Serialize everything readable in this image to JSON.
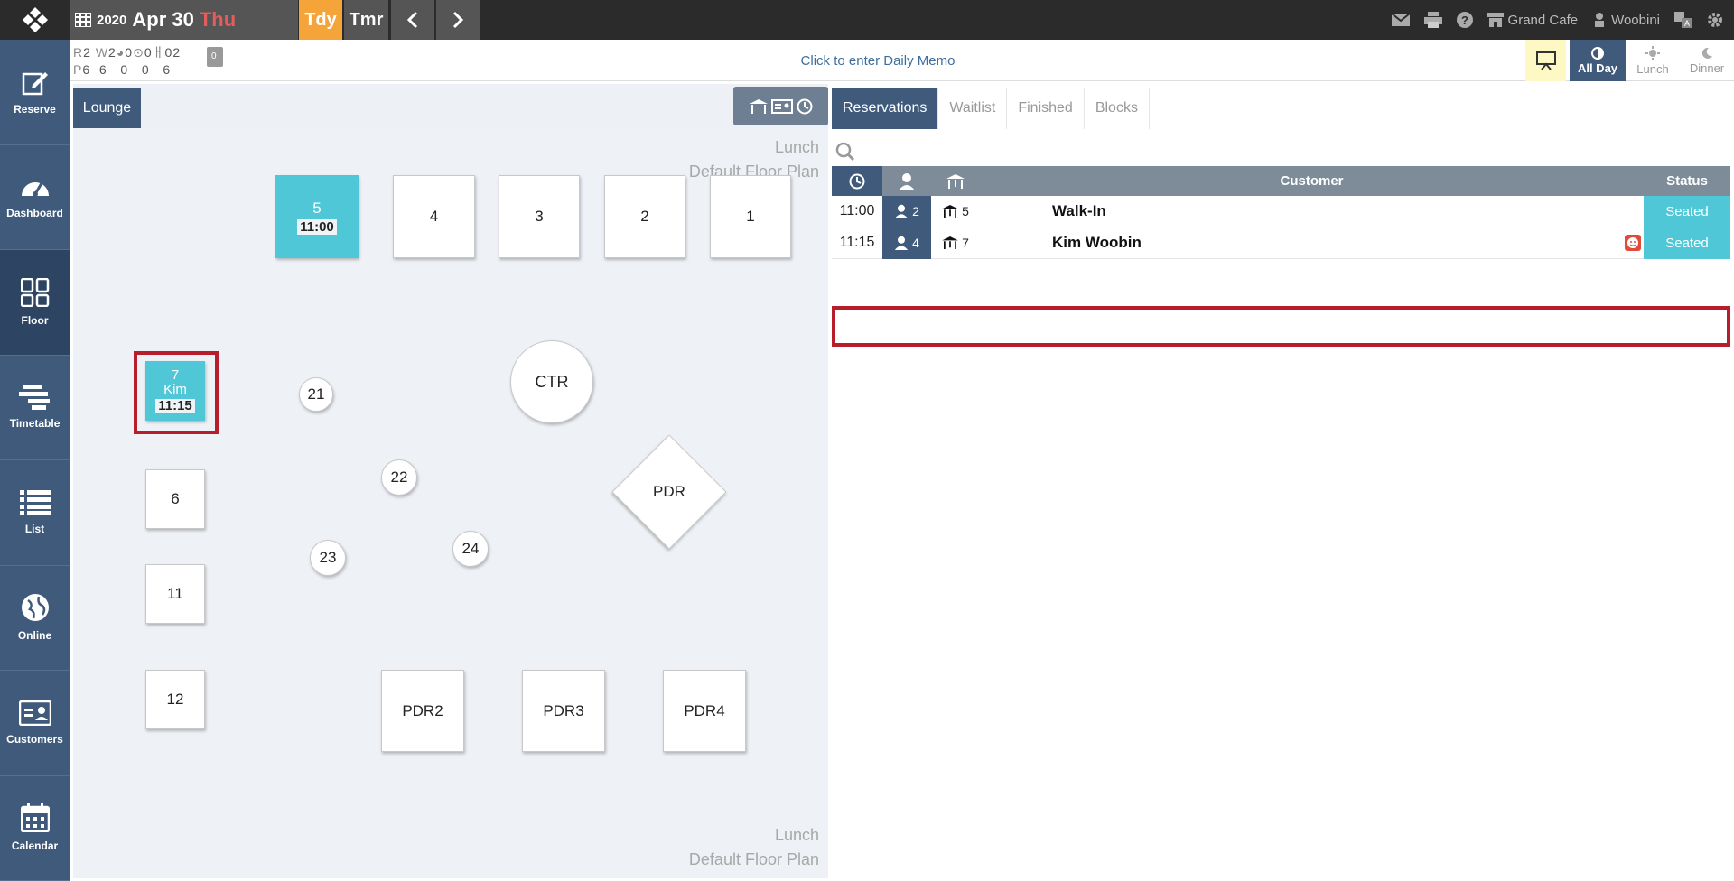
{
  "topbar": {
    "year": "2020",
    "month_day": "Apr 30",
    "weekday": "Thu",
    "today_label": "Tdy",
    "tomorrow_label": "Tmr",
    "restaurant": "Grand Cafe",
    "user": "Woobini"
  },
  "sidebar": {
    "items": [
      {
        "label": "Reserve",
        "icon": "edit-icon"
      },
      {
        "label": "Dashboard",
        "icon": "gauge-icon"
      },
      {
        "label": "Floor",
        "icon": "grid-icon"
      },
      {
        "label": "Timetable",
        "icon": "timeline-icon"
      },
      {
        "label": "List",
        "icon": "list-icon"
      },
      {
        "label": "Online",
        "icon": "globe-icon"
      },
      {
        "label": "Customers",
        "icon": "id-card-icon"
      },
      {
        "label": "Calendar",
        "icon": "calendar-icon"
      }
    ]
  },
  "info": {
    "counts_row1": [
      "R",
      "2",
      "W",
      "2",
      "0",
      "0",
      "0",
      "2"
    ],
    "counts_row2": [
      "P",
      "6",
      "6",
      "0",
      "0",
      "6"
    ],
    "clip_count": "0",
    "memo": "Click to enter Daily Memo",
    "shifts": [
      {
        "label": "All Day",
        "active": true
      },
      {
        "label": "Lunch",
        "active": false
      },
      {
        "label": "Dinner",
        "active": false
      }
    ]
  },
  "floor": {
    "area_tab": "Lounge",
    "shift_label": "Lunch",
    "plan_label": "Default Floor Plan",
    "tables": {
      "t5": {
        "num": "5",
        "time": "11:00"
      },
      "t4": "4",
      "t3": "3",
      "t2": "2",
      "t1": "1",
      "t7": {
        "num": "7",
        "name": "Kim",
        "time": "11:15"
      },
      "t21": "21",
      "tctr": "CTR",
      "t22": "22",
      "tpdr": "PDR",
      "t6": "6",
      "t23": "23",
      "t24": "24",
      "t11": "11",
      "t12": "12",
      "tpdr2": "PDR2",
      "tpdr3": "PDR3",
      "tpdr4": "PDR4"
    }
  },
  "reservations": {
    "tabs": [
      "Reservations",
      "Waitlist",
      "Finished",
      "Blocks"
    ],
    "headers": {
      "customer": "Customer",
      "status": "Status"
    },
    "rows": [
      {
        "time": "11:00",
        "party": "2",
        "table": "5",
        "customer": "Walk-In",
        "status": "Seated"
      },
      {
        "time": "11:15",
        "party": "4",
        "table": "7",
        "customer": "Kim Woobin",
        "status": "Seated"
      }
    ]
  },
  "colors": {
    "nav": "#3f5a7a",
    "seated": "#4fc7d6",
    "today": "#f5a43a",
    "highlight": "#b81d2b",
    "weekday": "#e45c5c"
  }
}
